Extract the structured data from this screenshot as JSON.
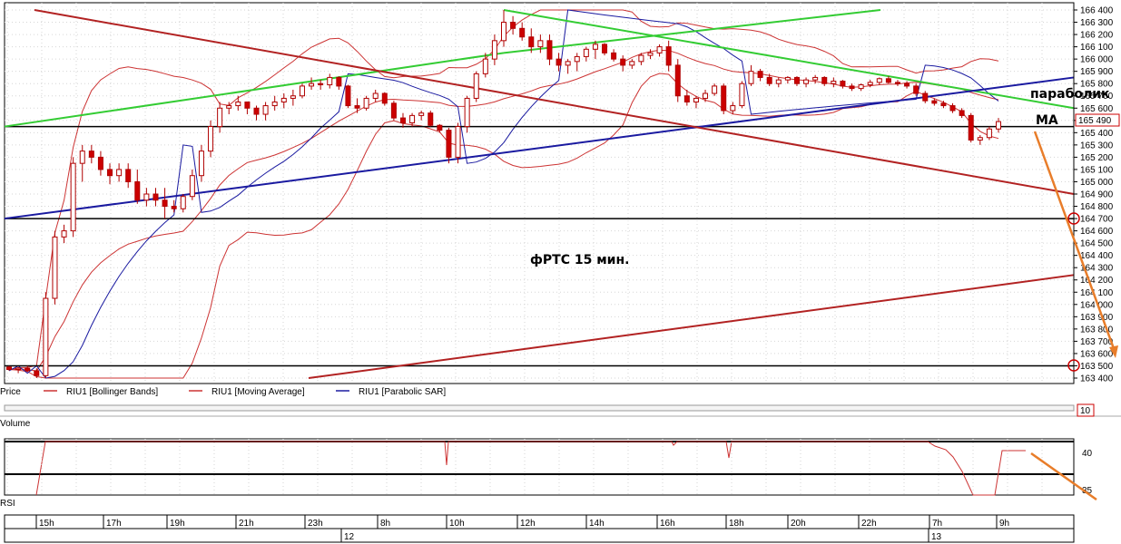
{
  "chart_data": {
    "type": "candlestick",
    "instrument": "RIU1",
    "title": "фРТС   15 мин.",
    "annotations": {
      "parabolic": "параболик",
      "ma": "МА"
    },
    "price_axis": {
      "ylim": [
        163400,
        166400
      ],
      "ticks": [
        166400,
        166300,
        166200,
        166100,
        166000,
        165900,
        165800,
        165700,
        165600,
        165500,
        165400,
        165300,
        165200,
        165100,
        165000,
        164900,
        164800,
        164700,
        164600,
        164500,
        164400,
        164300,
        164200,
        164100,
        164000,
        163900,
        163800,
        163700,
        163600,
        163500,
        163400
      ],
      "current_price": "165 490",
      "marked_levels": [
        "164 700",
        "163 500"
      ]
    },
    "legend": [
      {
        "name": "Price",
        "color": "#cc0000"
      },
      {
        "name": "RIU1 [Bollinger Bands]",
        "color": "#cc3333"
      },
      {
        "name": "RIU1 [Moving Average]",
        "color": "#cc3333"
      },
      {
        "name": "RIU1 [Parabolic SAR]",
        "color": "#1a1aa0"
      }
    ],
    "volume_panel": {
      "label": "Volume",
      "value": "10"
    },
    "rsi_panel": {
      "label": "RSI",
      "ticks": [
        "40",
        "35"
      ]
    },
    "time_axis": {
      "labels": [
        "15h",
        "17h",
        "19h",
        "21h",
        "23h",
        "8h",
        "10h",
        "12h",
        "14h",
        "16h",
        "18h",
        "20h",
        "22h",
        "7h",
        "9h"
      ],
      "dates": [
        "12",
        "13"
      ]
    },
    "candles": [
      [
        163490,
        163500,
        163460,
        163470
      ],
      [
        163470,
        163490,
        163440,
        163480
      ],
      [
        163480,
        163500,
        163450,
        163460
      ],
      [
        163460,
        163480,
        163400,
        163420
      ],
      [
        163420,
        164100,
        163400,
        164050
      ],
      [
        164050,
        164600,
        164000,
        164550
      ],
      [
        164550,
        164650,
        164500,
        164600
      ],
      [
        164600,
        165200,
        164550,
        165150
      ],
      [
        165150,
        165300,
        165000,
        165250
      ],
      [
        165250,
        165300,
        165150,
        165200
      ],
      [
        165200,
        165250,
        165050,
        165100
      ],
      [
        165100,
        165150,
        164980,
        165050
      ],
      [
        165050,
        165150,
        165000,
        165100
      ],
      [
        165100,
        165150,
        164950,
        165000
      ],
      [
        165000,
        165100,
        164820,
        164850
      ],
      [
        164850,
        164950,
        164800,
        164900
      ],
      [
        164900,
        164950,
        164800,
        164850
      ],
      [
        164850,
        164950,
        164700,
        164800
      ],
      [
        164800,
        164850,
        164750,
        164780
      ],
      [
        164780,
        164900,
        164750,
        164880
      ],
      [
        164880,
        165100,
        164850,
        165050
      ],
      [
        165050,
        165300,
        165000,
        165250
      ],
      [
        165250,
        165500,
        165200,
        165450
      ],
      [
        165450,
        165650,
        165400,
        165600
      ],
      [
        165600,
        165650,
        165550,
        165620
      ],
      [
        165620,
        165700,
        165580,
        165650
      ],
      [
        165650,
        165650,
        165550,
        165600
      ],
      [
        165600,
        165620,
        165500,
        165550
      ],
      [
        165550,
        165650,
        165500,
        165620
      ],
      [
        165620,
        165700,
        165580,
        165650
      ],
      [
        165650,
        165720,
        165600,
        165680
      ],
      [
        165680,
        165750,
        165620,
        165700
      ],
      [
        165700,
        165800,
        165680,
        165780
      ],
      [
        165780,
        165850,
        165750,
        165800
      ],
      [
        165800,
        165830,
        165750,
        165790
      ],
      [
        165790,
        165880,
        165760,
        165850
      ],
      [
        165850,
        165860,
        165750,
        165780
      ],
      [
        165780,
        165790,
        165600,
        165620
      ],
      [
        165620,
        165680,
        165560,
        165600
      ],
      [
        165600,
        165700,
        165580,
        165680
      ],
      [
        165680,
        165750,
        165650,
        165720
      ],
      [
        165720,
        165730,
        165620,
        165640
      ],
      [
        165640,
        165660,
        165500,
        165520
      ],
      [
        165520,
        165560,
        165440,
        165480
      ],
      [
        165480,
        165560,
        165450,
        165540
      ],
      [
        165540,
        165580,
        165500,
        165560
      ],
      [
        165560,
        165580,
        165450,
        165460
      ],
      [
        165460,
        165470,
        165400,
        165420
      ],
      [
        165420,
        165440,
        165150,
        165200
      ],
      [
        165200,
        165480,
        165150,
        165450
      ],
      [
        165450,
        165700,
        165400,
        165680
      ],
      [
        165680,
        165900,
        165650,
        165880
      ],
      [
        165880,
        166050,
        165850,
        166000
      ],
      [
        166000,
        166200,
        165950,
        166150
      ],
      [
        166150,
        166400,
        166100,
        166300
      ],
      [
        166300,
        166350,
        166200,
        166250
      ],
      [
        166250,
        166300,
        166150,
        166180
      ],
      [
        166180,
        166250,
        166050,
        166100
      ],
      [
        166100,
        166200,
        166050,
        166150
      ],
      [
        166150,
        166200,
        165950,
        166000
      ],
      [
        166000,
        166050,
        165900,
        165950
      ],
      [
        165950,
        166000,
        165880,
        165980
      ],
      [
        165980,
        166050,
        165900,
        166020
      ],
      [
        166020,
        166100,
        165980,
        166080
      ],
      [
        166080,
        166150,
        166000,
        166120
      ],
      [
        166120,
        166130,
        166030,
        166050
      ],
      [
        166050,
        166080,
        165980,
        166000
      ],
      [
        166000,
        166030,
        165900,
        165950
      ],
      [
        165950,
        166000,
        165920,
        165980
      ],
      [
        165980,
        166050,
        165950,
        166030
      ],
      [
        166030,
        166080,
        166000,
        166050
      ],
      [
        166050,
        166120,
        166020,
        166100
      ],
      [
        166100,
        166150,
        165900,
        165950
      ],
      [
        165950,
        166000,
        165650,
        165700
      ],
      [
        165700,
        165750,
        165620,
        165650
      ],
      [
        165650,
        165700,
        165600,
        165680
      ],
      [
        165680,
        165750,
        165650,
        165720
      ],
      [
        165720,
        165800,
        165700,
        165780
      ],
      [
        165780,
        165800,
        165550,
        165580
      ],
      [
        165580,
        165650,
        165550,
        165620
      ],
      [
        165620,
        165820,
        165600,
        165800
      ],
      [
        165800,
        165950,
        165780,
        165900
      ],
      [
        165900,
        165920,
        165820,
        165850
      ],
      [
        165850,
        165880,
        165780,
        165800
      ],
      [
        165800,
        165850,
        165770,
        165830
      ],
      [
        165830,
        165860,
        165800,
        165850
      ],
      [
        165850,
        165860,
        165780,
        165800
      ],
      [
        165800,
        165850,
        165770,
        165830
      ],
      [
        165830,
        165870,
        165800,
        165850
      ],
      [
        165850,
        165860,
        165780,
        165800
      ],
      [
        165800,
        165850,
        165770,
        165820
      ],
      [
        165820,
        165830,
        165760,
        165780
      ],
      [
        165780,
        165800,
        165740,
        165760
      ],
      [
        165760,
        165800,
        165740,
        165790
      ],
      [
        165790,
        165830,
        165770,
        165810
      ],
      [
        165810,
        165850,
        165790,
        165840
      ],
      [
        165840,
        165860,
        165800,
        165810
      ],
      [
        165810,
        165830,
        165780,
        165800
      ],
      [
        165800,
        165820,
        165760,
        165780
      ],
      [
        165780,
        165800,
        165700,
        165720
      ],
      [
        165720,
        165740,
        165640,
        165660
      ],
      [
        165660,
        165680,
        165620,
        165640
      ],
      [
        165640,
        165660,
        165600,
        165620
      ],
      [
        165620,
        165640,
        165560,
        165580
      ],
      [
        165580,
        165600,
        165520,
        165540
      ],
      [
        165540,
        165560,
        165320,
        165340
      ],
      [
        165340,
        165380,
        165300,
        165360
      ],
      [
        165360,
        165450,
        165340,
        165430
      ],
      [
        165430,
        165520,
        165400,
        165490
      ]
    ]
  }
}
